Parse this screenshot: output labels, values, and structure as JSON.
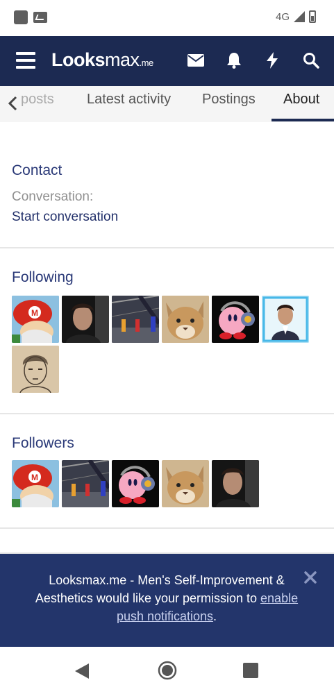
{
  "status_bar": {
    "network": "4G"
  },
  "header": {
    "logo_main": "Looks",
    "logo_max": "max",
    "logo_suffix": ".me"
  },
  "tabs": {
    "items": [
      {
        "label": "posts"
      },
      {
        "label": "Latest activity"
      },
      {
        "label": "Postings"
      },
      {
        "label": "About"
      }
    ],
    "active": "About"
  },
  "contact": {
    "title": "Contact",
    "conversation_label": "Conversation:",
    "conversation_link": "Start conversation"
  },
  "following": {
    "title": "Following",
    "avatars": [
      "mario-avatar",
      "man-dark-avatar",
      "gym-scene-avatar",
      "cat-avatar",
      "kirby-avatar",
      "man-portrait-avatar",
      "sketch-avatar"
    ]
  },
  "followers": {
    "title": "Followers",
    "avatars": [
      "mario-avatar",
      "gym-scene-avatar",
      "kirby-avatar",
      "cat-avatar",
      "man-dark-avatar"
    ]
  },
  "banner": {
    "text_before": "Looksmax.me - Men's Self-Improvement & Aesthetics would like your permission to ",
    "link_text": "enable push notifications",
    "text_after": "."
  },
  "colors": {
    "navbar": "#1c2a52",
    "title": "#2b3a78",
    "banner": "#23356b"
  }
}
